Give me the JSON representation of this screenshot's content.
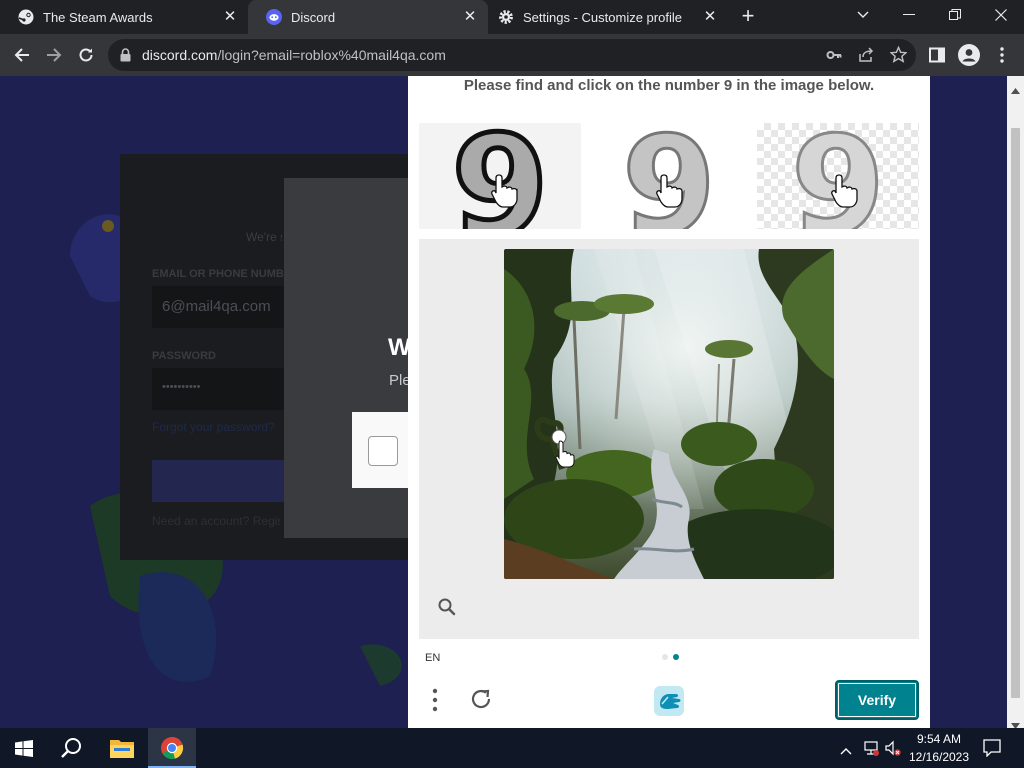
{
  "tabs": [
    {
      "title": "The Steam Awards",
      "icon": "steam-icon"
    },
    {
      "title": "Discord",
      "icon": "discord-icon",
      "active": true
    },
    {
      "title": "Settings - Customize profile",
      "icon": "gear-icon"
    }
  ],
  "toolbar": {
    "url_host": "discord.com",
    "url_path": "/login?email=roblox%40mail4qa.com"
  },
  "discord_bg": {
    "email_label": "EMAIL OR PHONE NUMBER",
    "email_value": "6@mail4qa.com",
    "password_label": "PASSWORD",
    "password_value": "••••••••••",
    "welcome_partial": "W",
    "please_partial": "Ple",
    "forgot_text": "Forgot your password?",
    "register_text": "Need an account? Register",
    "welcome_sub": "We're so excited to see you again!"
  },
  "captcha": {
    "prompt": "Please find and click on the number 9 in the image below.",
    "examples": [
      "9",
      "9",
      "9"
    ],
    "language": "EN",
    "verify_label": "Verify",
    "page_count": 2,
    "active_page": 2
  },
  "taskbar": {
    "time": "9:54 AM",
    "date": "12/16/2023"
  },
  "colors": {
    "accent": "#00838f",
    "chrome_dark": "#202124",
    "chrome_toolbar": "#35363a",
    "discord_bg": "#1a1c44"
  }
}
